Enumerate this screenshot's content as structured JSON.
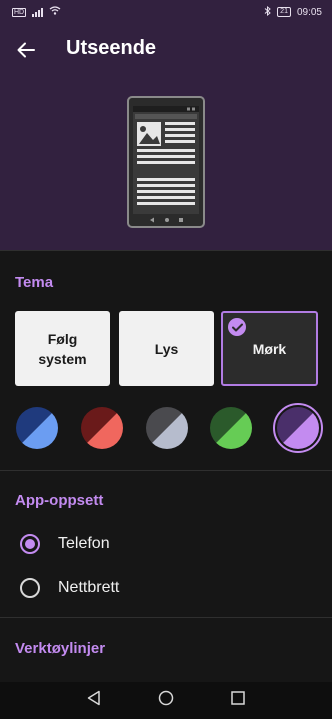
{
  "status": {
    "left_icons": [
      "hd-icon",
      "signal-icon",
      "wifi-icon"
    ],
    "hd_label": "HD",
    "bluetooth_icon": "bluetooth-icon",
    "battery": "21",
    "time": "09:05"
  },
  "header": {
    "title": "Utseende",
    "back_icon": "arrow-left-icon"
  },
  "preview": {
    "icon": "phone-preview-illustration"
  },
  "theme": {
    "section_title": "Tema",
    "options": [
      {
        "label": "Følg system",
        "selected": false
      },
      {
        "label": "Lys",
        "selected": false
      },
      {
        "label": "Mørk",
        "selected": true
      }
    ],
    "colors": [
      {
        "name": "blue",
        "dark": "#1f3a7d",
        "light": "#6b9df2",
        "selected": false
      },
      {
        "name": "red",
        "dark": "#6a1a1a",
        "light": "#f0675e",
        "selected": false
      },
      {
        "name": "grey",
        "dark": "#4a4a4e",
        "light": "#b6bccd",
        "selected": false
      },
      {
        "name": "green",
        "dark": "#2b5a2b",
        "light": "#66cc55",
        "selected": false
      },
      {
        "name": "purple",
        "dark": "#4a2f6a",
        "light": "#c38bf0",
        "selected": true
      }
    ]
  },
  "layout": {
    "section_title": "App-oppsett",
    "options": [
      {
        "label": "Telefon",
        "selected": true
      },
      {
        "label": "Nettbrett",
        "selected": false
      }
    ]
  },
  "toolbars": {
    "section_title": "Verktøylinjer"
  },
  "colors": {
    "accent": "#c38bf0",
    "header_bg": "#32213f",
    "page_bg": "#161616"
  }
}
